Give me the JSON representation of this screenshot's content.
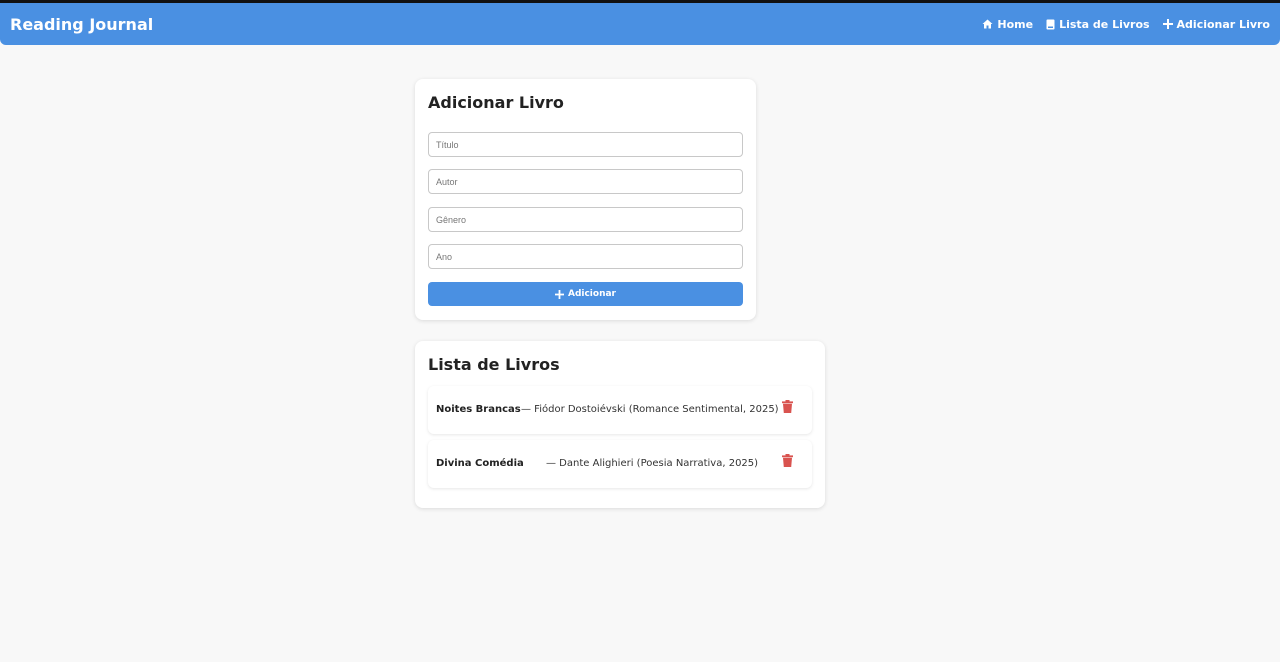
{
  "navbar": {
    "brand": "Reading Journal",
    "links": [
      {
        "label": "Home",
        "icon": "home-icon"
      },
      {
        "label": "Lista de Livros",
        "icon": "book-icon"
      },
      {
        "label": "Adicionar Livro",
        "icon": "plus-icon"
      }
    ]
  },
  "form": {
    "title": "Adicionar Livro",
    "fields": [
      {
        "placeholder": "Título",
        "value": ""
      },
      {
        "placeholder": "Autor",
        "value": ""
      },
      {
        "placeholder": "Gênero",
        "value": ""
      },
      {
        "placeholder": "Ano",
        "value": ""
      }
    ],
    "submit_label": "Adicionar",
    "submit_icon": "plus-icon"
  },
  "list": {
    "title": "Lista de Livros",
    "books": [
      {
        "title": "Noites Brancas",
        "details": "— Fiódor Dostoiévski (Romance Sentimental, 2025)"
      },
      {
        "title": "Divina Comédia",
        "details": "— Dante Alighieri (Poesia Narrativa, 2025)"
      }
    ],
    "delete_icon": "trash-icon"
  },
  "colors": {
    "primary": "#4a90e2",
    "danger": "#d9534f",
    "background": "#f8f8f8"
  }
}
